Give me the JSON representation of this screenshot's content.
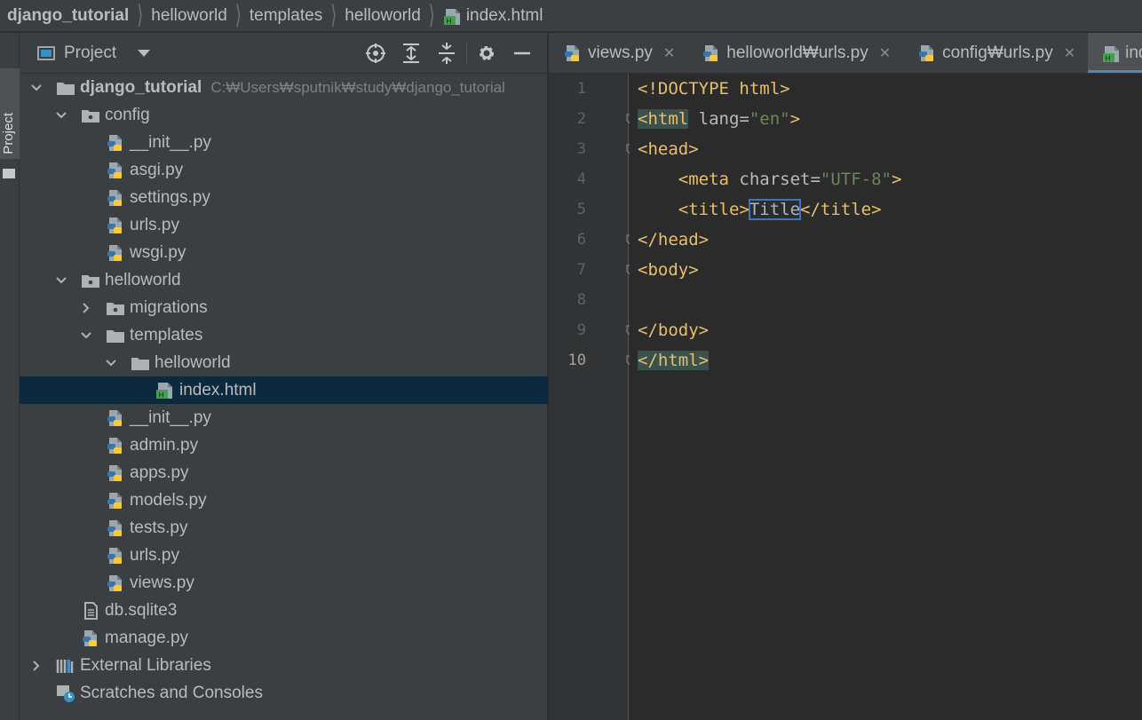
{
  "breadcrumb": [
    "django_tutorial",
    "helloworld",
    "templates",
    "helloworld",
    "index.html"
  ],
  "stripe": {
    "label": "Project"
  },
  "project_panel": {
    "title": "Project",
    "tools": [
      "crosshair-icon",
      "expand-all-icon",
      "collapse-all-icon",
      "gear-icon",
      "minimize-icon"
    ]
  },
  "tree": [
    {
      "name": "django_tutorial",
      "hint": "C:₩Users₩sputnik₩study₩django_tutorial",
      "type": "folder",
      "depth": 0,
      "expanded": true,
      "bold": true
    },
    {
      "name": "config",
      "type": "package",
      "depth": 1,
      "expanded": true
    },
    {
      "name": "__init__.py",
      "type": "python",
      "depth": 2
    },
    {
      "name": "asgi.py",
      "type": "python",
      "depth": 2
    },
    {
      "name": "settings.py",
      "type": "python",
      "depth": 2
    },
    {
      "name": "urls.py",
      "type": "python",
      "depth": 2
    },
    {
      "name": "wsgi.py",
      "type": "python",
      "depth": 2
    },
    {
      "name": "helloworld",
      "type": "package",
      "depth": 1,
      "expanded": true
    },
    {
      "name": "migrations",
      "type": "package",
      "depth": 2,
      "expanded": false
    },
    {
      "name": "templates",
      "type": "folder",
      "depth": 2,
      "expanded": true
    },
    {
      "name": "helloworld",
      "type": "folder",
      "depth": 3,
      "expanded": true
    },
    {
      "name": "index.html",
      "type": "html",
      "depth": 4,
      "selected": true
    },
    {
      "name": "__init__.py",
      "type": "python",
      "depth": 2
    },
    {
      "name": "admin.py",
      "type": "python",
      "depth": 2
    },
    {
      "name": "apps.py",
      "type": "python",
      "depth": 2
    },
    {
      "name": "models.py",
      "type": "python",
      "depth": 2
    },
    {
      "name": "tests.py",
      "type": "python",
      "depth": 2
    },
    {
      "name": "urls.py",
      "type": "python",
      "depth": 2
    },
    {
      "name": "views.py",
      "type": "python",
      "depth": 2
    },
    {
      "name": "db.sqlite3",
      "type": "db",
      "depth": 1
    },
    {
      "name": "manage.py",
      "type": "python",
      "depth": 1
    },
    {
      "name": "External Libraries",
      "type": "libraries",
      "depth": 0,
      "expanded": false
    },
    {
      "name": "Scratches and Consoles",
      "type": "scratches",
      "depth": 0
    }
  ],
  "tabs": [
    {
      "label": "views.py",
      "icon": "python",
      "closable": true
    },
    {
      "label": "helloworld₩urls.py",
      "icon": "python",
      "closable": true
    },
    {
      "label": "config₩urls.py",
      "icon": "python",
      "closable": true
    },
    {
      "label": "index",
      "icon": "html",
      "active": true
    }
  ],
  "editor": {
    "current_line": 10,
    "lines": [
      {
        "n": "1",
        "indent": "",
        "tokens": [
          [
            "tag",
            "<!DOCTYPE html>"
          ]
        ]
      },
      {
        "n": "2",
        "indent": "",
        "fold": true,
        "tokens": [
          [
            "tag hl-tag",
            "<html"
          ],
          [
            "attr",
            " lang="
          ],
          [
            "val",
            "\"en\""
          ],
          [
            "tag",
            ">"
          ]
        ]
      },
      {
        "n": "3",
        "indent": "",
        "fold": true,
        "tokens": [
          [
            "tag",
            "<head>"
          ]
        ]
      },
      {
        "n": "4",
        "indent": "    ",
        "tokens": [
          [
            "tag",
            "<meta"
          ],
          [
            "attr",
            " charset="
          ],
          [
            "val",
            "\"UTF-8\""
          ],
          [
            "tag",
            ">"
          ]
        ]
      },
      {
        "n": "5",
        "indent": "    ",
        "tokens": [
          [
            "tag",
            "<title>"
          ],
          [
            "txt box",
            "Title"
          ],
          [
            "tag",
            "</title>"
          ]
        ]
      },
      {
        "n": "6",
        "indent": "",
        "fold": true,
        "tokens": [
          [
            "tag",
            "</head>"
          ]
        ]
      },
      {
        "n": "7",
        "indent": "",
        "fold": true,
        "tokens": [
          [
            "tag",
            "<body>"
          ]
        ]
      },
      {
        "n": "8",
        "indent": "",
        "tokens": []
      },
      {
        "n": "9",
        "indent": "",
        "fold": true,
        "tokens": [
          [
            "tag",
            "</body>"
          ]
        ]
      },
      {
        "n": "10",
        "indent": "",
        "fold": true,
        "tokens": [
          [
            "tag hl-tag",
            "</html>"
          ]
        ]
      }
    ]
  },
  "colors": {
    "accent": "#4a88c7",
    "selection": "#0d293e",
    "tag": "#e8bf6a",
    "string": "#6a8759"
  }
}
